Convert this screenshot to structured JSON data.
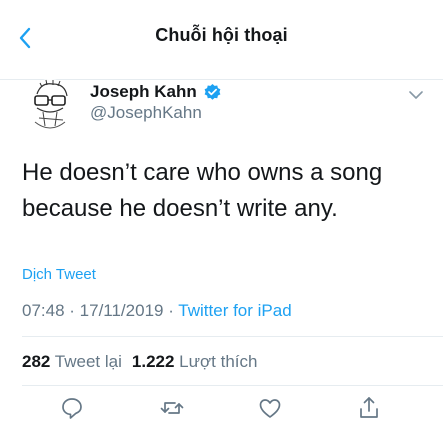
{
  "header": {
    "title": "Chuỗi hội thoại"
  },
  "tweet": {
    "author_name": "Joseph Kahn",
    "author_handle": "@JosephKahn",
    "text": "He doesn’t care who owns a song because he doesn’t write any.",
    "translate_label": "Dịch Tweet",
    "time": "07:48",
    "date": "17/11/2019",
    "separator1": " · ",
    "separator2": " · ",
    "client": "Twitter for iPad",
    "retweet_count": "282",
    "retweet_label": "Tweet lại",
    "like_count": "1.222",
    "like_label": "Lượt thích"
  },
  "actions": {
    "icons": [
      "reply-icon",
      "retweet-icon",
      "like-icon",
      "share-icon"
    ]
  },
  "colors": {
    "accent": "#1da1f2",
    "text": "#14171a",
    "muted": "#657786",
    "divider": "#e6ecf0"
  }
}
